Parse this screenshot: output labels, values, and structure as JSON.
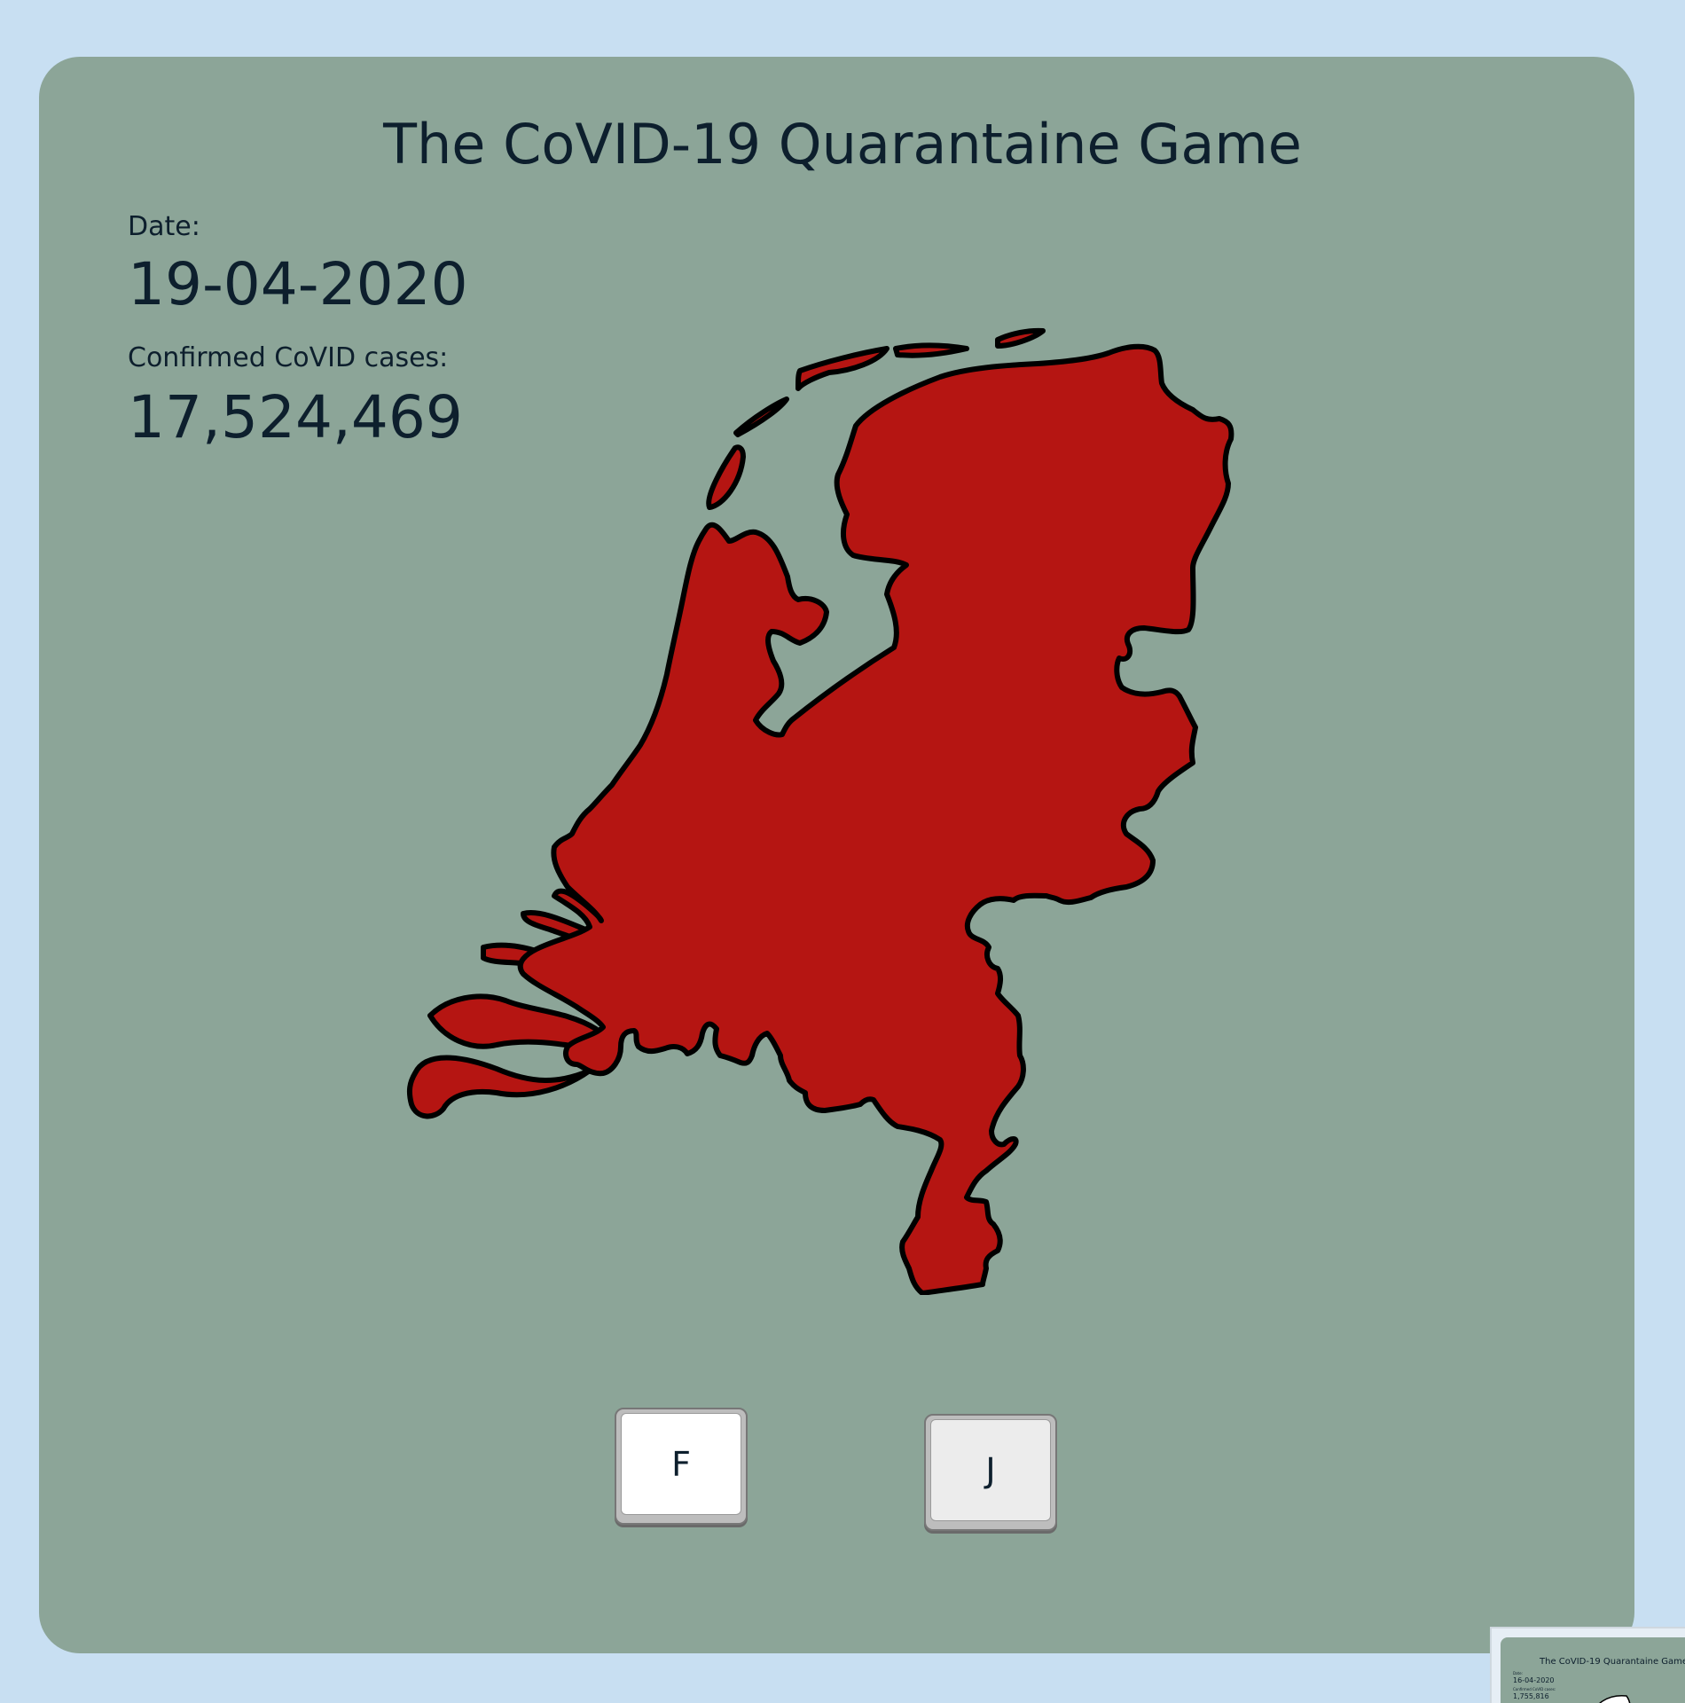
{
  "game": {
    "title": "The CoVID-19 Quarantaine Game",
    "date_label": "Date:",
    "date_value": "19-04-2020",
    "cases_label": "Confirmed CoVID cases:",
    "cases_value": "17,524,469"
  },
  "map": {
    "region": "Netherlands",
    "fill_color": "#b51512",
    "outline_color": "#000000"
  },
  "keys": {
    "left_label": "F",
    "right_label": "J"
  },
  "thumbnail": {
    "title": "The CoVID-19 Quarantaine Game",
    "date_label": "Date:",
    "date_value": "16-04-2020",
    "cases_label": "Confirmed CoVID cases:",
    "cases_value": "1,755,816"
  },
  "colors": {
    "page_background": "#c8dff2",
    "panel_background": "#8ca598",
    "text": "#0d1f2d"
  }
}
